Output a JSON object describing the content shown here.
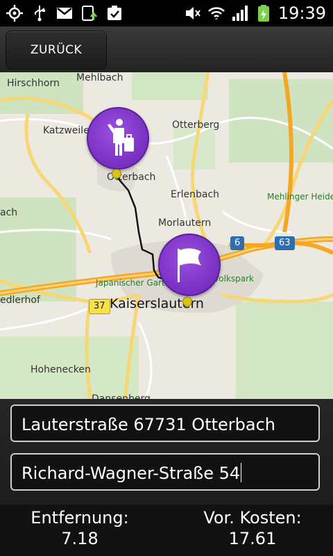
{
  "status_bar": {
    "time": "19:39",
    "left_icons": [
      "gps-icon",
      "usb-icon",
      "gmail-icon",
      "sync-icon",
      "task-icon"
    ],
    "right_icons": [
      "mute-icon",
      "wifi-icon",
      "signal-icon",
      "battery-icon"
    ]
  },
  "toolbar": {
    "back_label": "ZURÜCK"
  },
  "map": {
    "labels": {
      "hirschhorn": "Hirschhorn",
      "mehlbach": "Mehlbach",
      "katzweiler": "Katzweiler",
      "otterberg": "Otterberg",
      "otterbach": "Otterbach",
      "erlenbach": "Erlenbach",
      "mehlinger_heide": "Mehlinger Heide",
      "morlautern": "Morlautern",
      "ach": "ach",
      "japanischer_garten": "Japanischer Garten",
      "volkspark": "Volkspark",
      "edlerhof": "edlerhof",
      "kaiserslautern": "Kaiserslautern",
      "hohenecken": "Hohenecken",
      "dansenberg": "Dansenberg"
    },
    "road_badges": {
      "a6": "6",
      "a63": "63",
      "b37": "37"
    },
    "start_pin_icon": "traveler-with-luggage-icon",
    "end_pin_icon": "flag-icon",
    "colors": {
      "pin": "#7b35c9",
      "route": "#111111"
    }
  },
  "form": {
    "origin_value": "Lauterstraße  67731 Otterbach",
    "destination_value": "Richard-Wagner-Straße 54"
  },
  "summary": {
    "distance_label": "Entfernung:",
    "distance_value": "7.18",
    "cost_label": "Vor. Kosten:",
    "cost_value": "17.61"
  }
}
